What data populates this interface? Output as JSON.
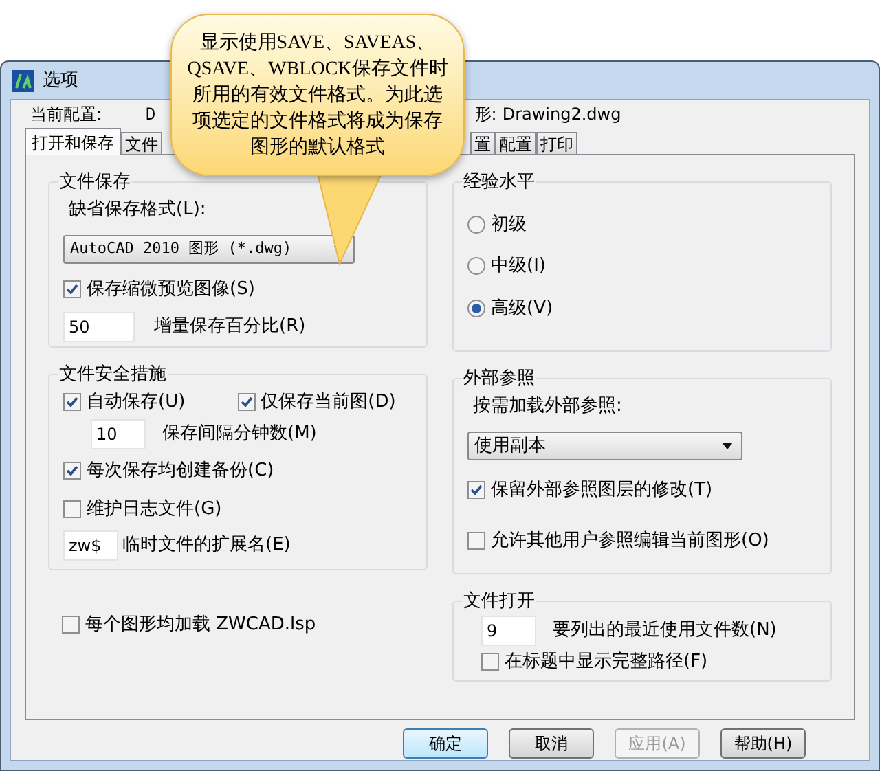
{
  "window": {
    "title": "选项"
  },
  "callout": {
    "text": "显示使用SAVE、SAVEAS、QSAVE、WBLOCK保存文件时所用的有效文件格式。为此选项选定的文件格式将成为保存图形的默认格式"
  },
  "header": {
    "profile_label": "当前配置:",
    "profile_value": "D",
    "drawing_label": "形:",
    "drawing_value": "Drawing2.dwg"
  },
  "tabs": [
    {
      "label": "打开和保存",
      "selected": true
    },
    {
      "label": "文件",
      "selected": false
    },
    {
      "label": "置",
      "selected": false
    },
    {
      "label": "配置",
      "selected": false
    },
    {
      "label": "打印",
      "selected": false
    }
  ],
  "file_save": {
    "title": "文件保存",
    "format_label": "缺省保存格式(L):",
    "format_value": "AutoCAD 2010 图形 (*.dwg)",
    "thumbnail": {
      "label": "保存缩微预览图像(S)",
      "checked": true
    },
    "incremental_value": "50",
    "incremental_label": "增量保存百分比(R)"
  },
  "experience": {
    "title": "经验水平",
    "options": [
      {
        "label": "初级",
        "selected": false
      },
      {
        "label": "中级(I)",
        "selected": false
      },
      {
        "label": "高级(V)",
        "selected": true
      }
    ]
  },
  "safety": {
    "title": "文件安全措施",
    "autosave": {
      "label": "自动保存(U)",
      "checked": true
    },
    "current_only": {
      "label": "仅保存当前图(D)",
      "checked": true
    },
    "interval_value": "10",
    "interval_label": "保存间隔分钟数(M)",
    "backup": {
      "label": "每次保存均创建备份(C)",
      "checked": true
    },
    "log": {
      "label": "维护日志文件(G)",
      "checked": false
    },
    "temp_ext_value": "zw$",
    "temp_ext_label": "临时文件的扩展名(E)"
  },
  "load_lsp": {
    "label": "每个图形均加载 ZWCAD.lsp",
    "checked": false
  },
  "xref": {
    "title": "外部参照",
    "demand_label": "按需加载外部参照:",
    "demand_value": "使用副本",
    "retain_layers": {
      "label": "保留外部参照图层的修改(T)",
      "checked": true
    },
    "allow_edit": {
      "label": "允许其他用户参照编辑当前图形(O)",
      "checked": false
    }
  },
  "file_open": {
    "title": "文件打开",
    "recent_value": "9",
    "recent_label": "要列出的最近使用文件数(N)",
    "full_path": {
      "label": "在标题中显示完整路径(F)",
      "checked": false
    }
  },
  "buttons": [
    {
      "label": "确定",
      "kind": "default"
    },
    {
      "label": "取消",
      "kind": "normal"
    },
    {
      "label": "应用(A)",
      "kind": "disabled"
    },
    {
      "label": "帮助(H)",
      "kind": "normal"
    }
  ]
}
